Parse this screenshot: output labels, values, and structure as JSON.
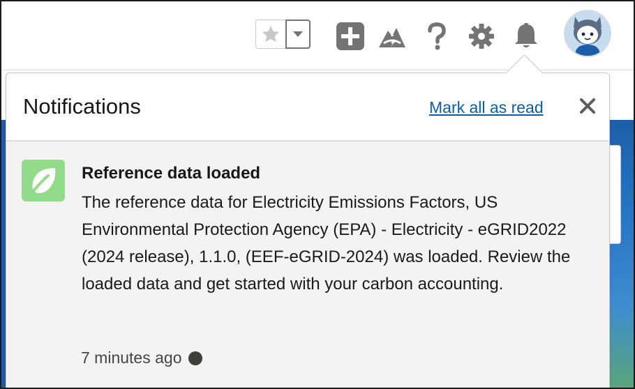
{
  "header": {
    "icons": [
      "star-icon",
      "chevron-down-icon",
      "add-icon",
      "trailhead-icon",
      "help-icon",
      "gear-icon",
      "bell-icon",
      "avatar"
    ]
  },
  "notifications": {
    "title": "Notifications",
    "mark_all_read": "Mark all as read",
    "items": [
      {
        "title": "Reference data loaded",
        "body": "The reference data for Electricity Emissions Factors, US Environmental Protection Agency (EPA) - Electricity - eGRID2022 (2024 release), 1.1.0, (EEF-eGRID-2024) was loaded. Review the loaded data and get started with your carbon accounting.",
        "time": "7 minutes ago",
        "icon": "leaf-icon",
        "unread": true
      }
    ]
  },
  "colors": {
    "link": "#0b5cab",
    "icon_gray": "#747474",
    "leaf_bg": "#91db8b",
    "item_bg": "#f3f3f3"
  }
}
